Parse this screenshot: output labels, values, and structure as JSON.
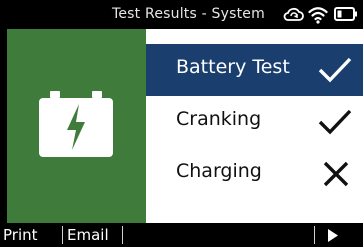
{
  "header": {
    "title": "Test Results - System",
    "icons": [
      "cloud-sync-icon",
      "wifi-icon",
      "battery-level-icon"
    ]
  },
  "left_panel": {
    "icon": "battery-charge-icon",
    "background_color": "#3f7b3a"
  },
  "results": [
    {
      "label": "Battery Test",
      "status": "pass",
      "status_icon": "check-icon",
      "selected": true
    },
    {
      "label": "Cranking",
      "status": "pass",
      "status_icon": "check-icon",
      "selected": false
    },
    {
      "label": "Charging",
      "status": "fail",
      "status_icon": "x-icon",
      "selected": false
    }
  ],
  "softkeys": {
    "print": "Print",
    "email": "Email",
    "next_icon": "play-arrow-icon"
  },
  "colors": {
    "selected_row": "#1a3f6e",
    "panel_green": "#3f7b3a"
  }
}
